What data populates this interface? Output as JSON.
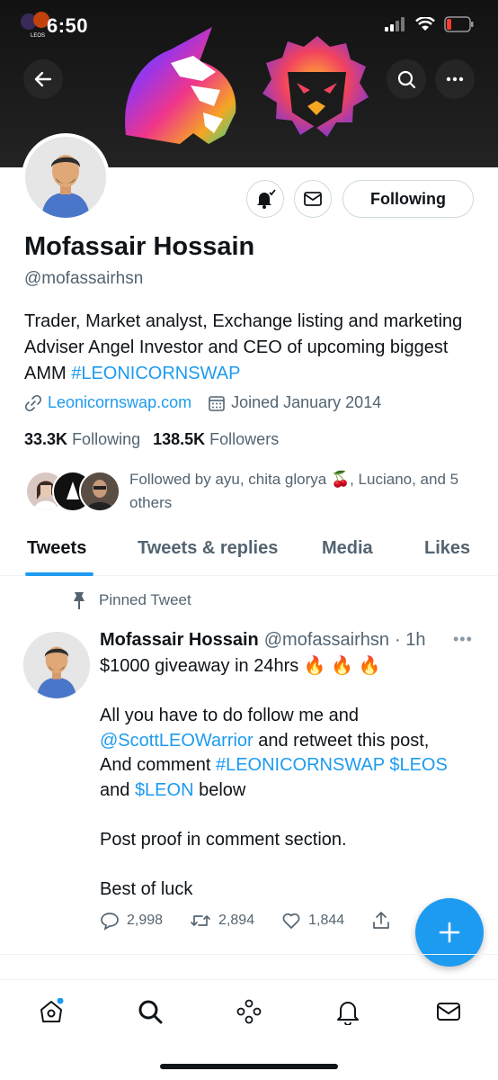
{
  "status_bar": {
    "time": "6:50",
    "app_badge": "LEOS"
  },
  "profile": {
    "name": "Mofassair Hossain",
    "handle": "@mofassairhsn",
    "bio_text": "Trader, Market analyst, Exchange listing and marketing Adviser Angel Investor and CEO of upcoming biggest AMM ",
    "bio_hashtag": "#LEONICORNSWAP",
    "website": "Leonicornswap.com",
    "joined": "Joined January 2014",
    "following_count": "33.3K",
    "following_label": "Following",
    "followers_count": "138.5K",
    "followers_label": "Followers",
    "followed_by": "Followed by ayu, chita glorya 🍒, Luciano, and 5 others",
    "follow_button_label": "Following"
  },
  "tabs": [
    {
      "label": "Tweets",
      "active": true
    },
    {
      "label": "Tweets & replies",
      "active": false
    },
    {
      "label": "Media",
      "active": false
    },
    {
      "label": "Likes",
      "active": false
    }
  ],
  "tweet": {
    "pinned_label": "Pinned Tweet",
    "author_name": "Mofassair Hossain",
    "author_handle": "@mofassairhsn",
    "time": "· 1h",
    "line1": "$1000 giveaway in 24hrs 🔥 🔥 🔥",
    "line2": "All you have to do follow me and",
    "mention": "@ScottLEOWarrior",
    "line3_rest": " and retweet this post,",
    "line4_text": "And comment ",
    "hashtag": "#LEONICORNSWAP",
    "cashtag1": "$LEOS",
    "line5_text": "and ",
    "cashtag2": "$LEON",
    "line5_rest": " below",
    "line6": "Post proof in comment section.",
    "line7": "Best of luck",
    "replies": "2,998",
    "retweets": "2,894",
    "likes": "1,844"
  },
  "colors": {
    "accent": "#1d9bf0",
    "text": "#0f1419",
    "muted": "#536471",
    "border": "#cfd9de"
  },
  "icons": [
    "back-arrow-icon",
    "search-icon",
    "more-icon",
    "bell-check-icon",
    "mail-icon",
    "link-icon",
    "calendar-icon",
    "pin-icon",
    "reply-icon",
    "retweet-icon",
    "like-icon",
    "share-icon",
    "plus-icon",
    "home-icon",
    "explore-icon",
    "spaces-icon",
    "notifications-icon",
    "messages-icon"
  ]
}
